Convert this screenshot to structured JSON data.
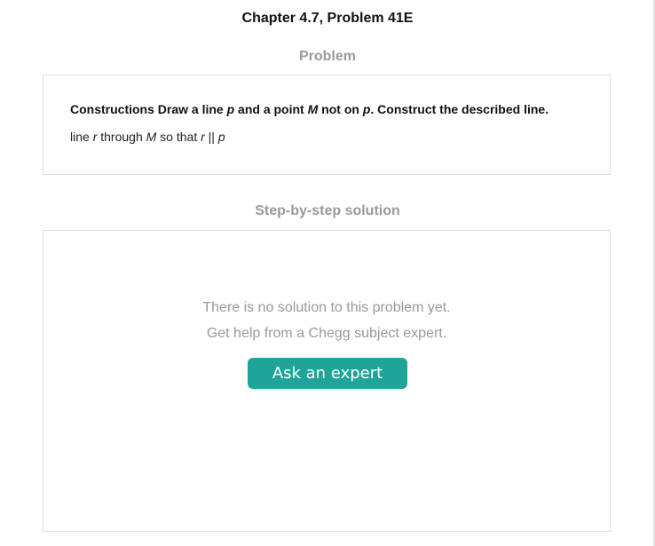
{
  "page": {
    "title": "Chapter 4.7, Problem 41E"
  },
  "problem": {
    "heading": "Problem",
    "statement_parts": [
      {
        "text": "Constructions Draw a line ",
        "italic": false
      },
      {
        "text": "p",
        "italic": true
      },
      {
        "text": " and a point ",
        "italic": false
      },
      {
        "text": "M",
        "italic": true
      },
      {
        "text": " not on ",
        "italic": false
      },
      {
        "text": "p",
        "italic": true
      },
      {
        "text": ". Construct the described line.",
        "italic": false
      }
    ],
    "part_parts": [
      {
        "text": "line ",
        "italic": false
      },
      {
        "text": "r",
        "italic": true
      },
      {
        "text": " through ",
        "italic": false
      },
      {
        "text": "M",
        "italic": true
      },
      {
        "text": " so that ",
        "italic": false
      },
      {
        "text": "r",
        "italic": true
      },
      {
        "text": " || ",
        "italic": false
      },
      {
        "text": "p",
        "italic": true
      }
    ]
  },
  "solution": {
    "heading": "Step-by-step solution",
    "empty_line1": "There is no solution to this problem yet.",
    "empty_line2": "Get help from a Chegg subject expert.",
    "button_label": "Ask an expert"
  },
  "colors": {
    "accent": "#20a399",
    "heading_gray": "#9a9a9a",
    "message_gray": "#999999",
    "border": "#dcdcdc"
  }
}
